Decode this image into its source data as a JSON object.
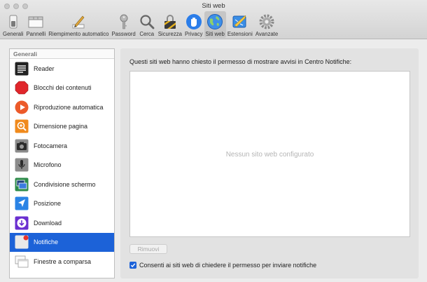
{
  "window": {
    "title": "Siti web"
  },
  "toolbar": {
    "items": [
      {
        "label": "Generali",
        "icon": "general-switch-icon",
        "active": false
      },
      {
        "label": "Pannelli",
        "icon": "tabs-icon",
        "active": false
      },
      {
        "label": "Riempimento automatico",
        "icon": "autofill-pencil-icon",
        "active": false
      },
      {
        "label": "Password",
        "icon": "key-icon",
        "active": false
      },
      {
        "label": "Cerca",
        "icon": "magnifier-icon",
        "active": false
      },
      {
        "label": "Sicurezza",
        "icon": "security-lock-icon",
        "active": false
      },
      {
        "label": "Privacy",
        "icon": "privacy-hand-icon",
        "active": false
      },
      {
        "label": "Siti web",
        "icon": "globe-icon",
        "active": true
      },
      {
        "label": "Estensioni",
        "icon": "extensions-icon",
        "active": false
      },
      {
        "label": "Avanzate",
        "icon": "gear-icon",
        "active": false
      }
    ]
  },
  "sidebar": {
    "header": "Generali",
    "items": [
      {
        "label": "Reader",
        "icon": "reader-icon"
      },
      {
        "label": "Blocchi dei contenuti",
        "icon": "stop-sign-icon"
      },
      {
        "label": "Riproduzione automatica",
        "icon": "play-icon"
      },
      {
        "label": "Dimensione pagina",
        "icon": "zoom-icon"
      },
      {
        "label": "Fotocamera",
        "icon": "camera-icon"
      },
      {
        "label": "Microfono",
        "icon": "microphone-icon"
      },
      {
        "label": "Condivisione schermo",
        "icon": "screen-share-icon"
      },
      {
        "label": "Posizione",
        "icon": "location-arrow-icon"
      },
      {
        "label": "Download",
        "icon": "download-icon"
      },
      {
        "label": "Notifiche",
        "icon": "notifications-icon"
      },
      {
        "label": "Finestre a comparsa",
        "icon": "popup-windows-icon"
      }
    ],
    "selected_index": 9
  },
  "panel": {
    "description": "Questi siti web hanno chiesto il permesso di mostrare avvisi in Centro Notifiche:",
    "empty_text": "Nessun sito web configurato",
    "remove_label": "Rimuovi",
    "checkbox_label": "Consenti ai siti web di chiedere il permesso per inviare notifiche",
    "checkbox_checked": true
  },
  "colors": {
    "accent": "#1c62d8"
  }
}
